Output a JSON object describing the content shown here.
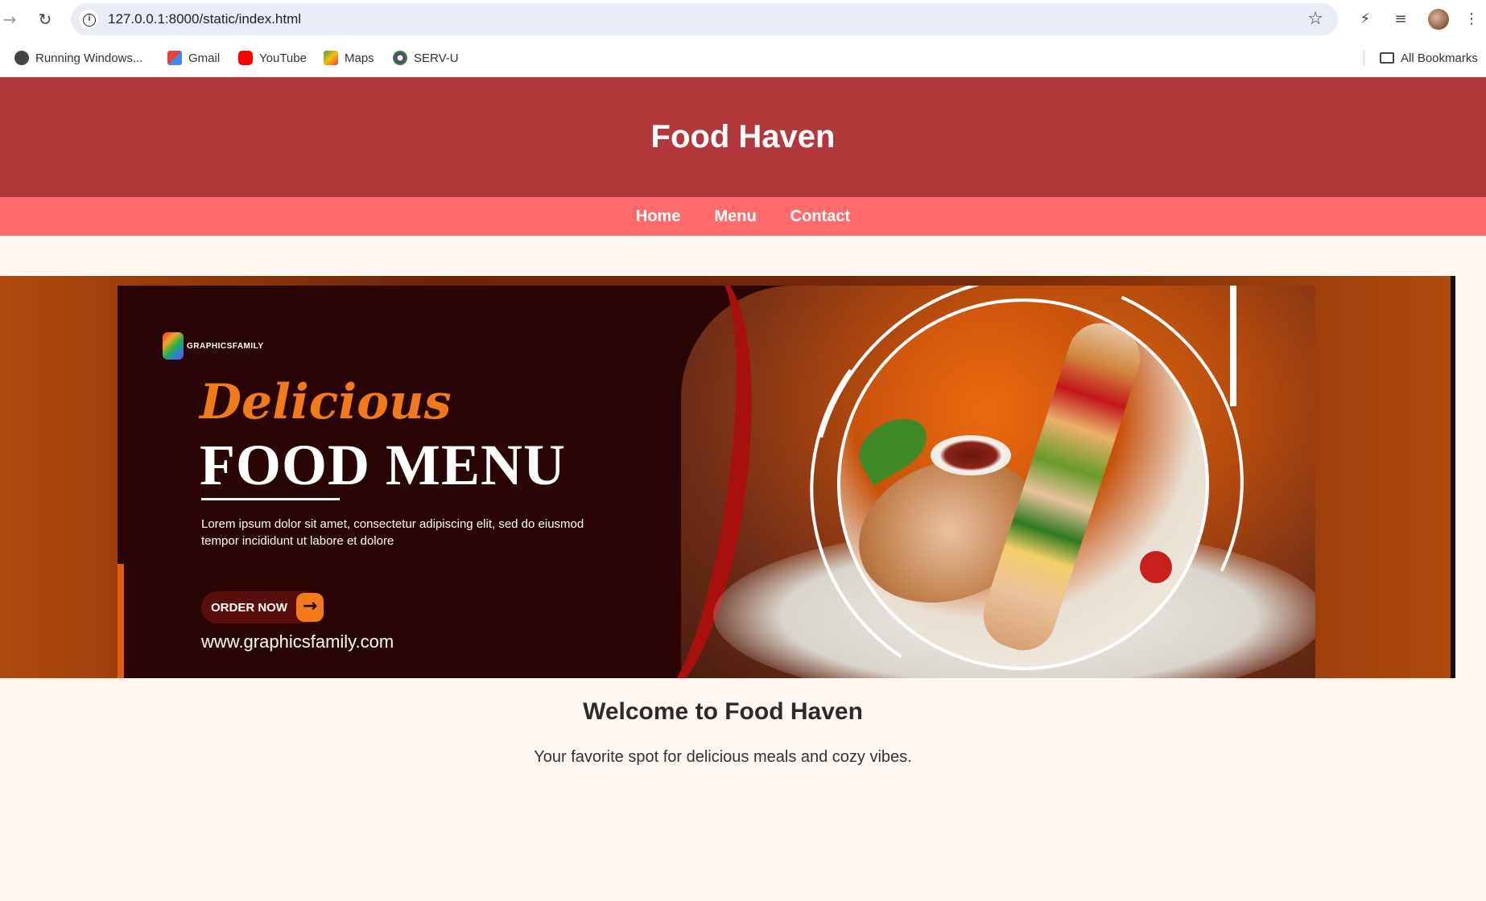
{
  "browser": {
    "url": "127.0.0.1:8000/static/index.html",
    "bookmarks": [
      "Running Windows...",
      "Gmail",
      "YouTube",
      "Maps",
      "SERV-U"
    ],
    "all_bookmarks": "All Bookmarks"
  },
  "site": {
    "title": "Food Haven",
    "nav": [
      "Home",
      "Menu",
      "Contact"
    ],
    "welcome_heading": "Welcome to Food Haven",
    "welcome_text": "Your favorite spot for delicious meals and cozy vibes."
  },
  "banner": {
    "logo_text": "GRAPHICSFAMILY",
    "script_word": "Delicious",
    "headline": "FOOD MENU",
    "lorem": "Lorem ipsum dolor sit amet, consectetur adipiscing elit, sed do eiusmod tempor incididunt ut labore et dolore",
    "cta": "ORDER NOW",
    "website": "www.graphicsfamily.com"
  },
  "colors": {
    "header_bg": "#b3383b",
    "nav_bg": "#ff6b6b",
    "page_bg": "#fff8f2"
  },
  "icons": {
    "back": "back-arrow-icon",
    "reload": "reload-icon",
    "site_info": "info-icon",
    "bookmark_star": "star-icon",
    "extensions": "extension-icon",
    "media": "media-control-icon",
    "menu": "kebab-menu-icon",
    "folder": "folder-icon"
  }
}
